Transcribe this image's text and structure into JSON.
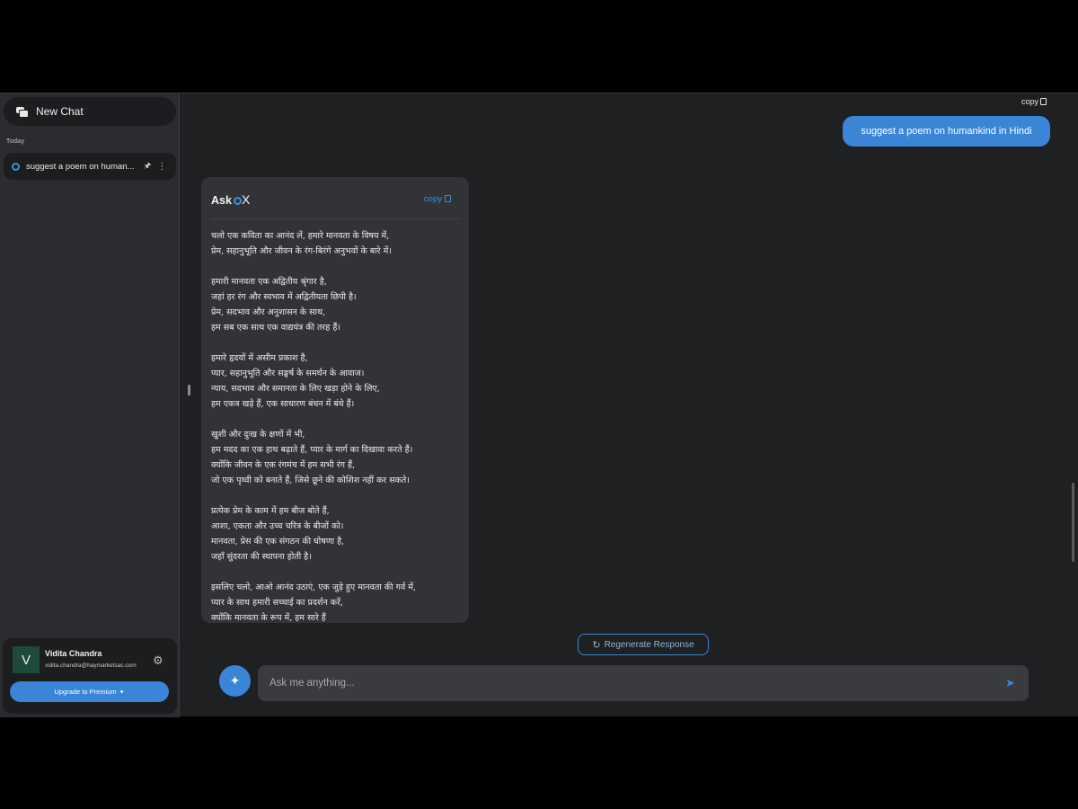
{
  "sidebar": {
    "new_chat_label": "New Chat",
    "section_label": "Today",
    "history": [
      {
        "title": "suggest a poem on human...",
        "pin_icon": "pin-icon",
        "menu_icon": "more-vertical-icon"
      }
    ],
    "user": {
      "initial": "V",
      "name": "Vidita Chandra",
      "email": "vidita.chandra@haymarketsac.com",
      "upgrade_label": "Upgrade to Premium"
    }
  },
  "conversation": {
    "top_copy_label": "copy",
    "user_message": "suggest a poem on humankind in Hindi",
    "bot": {
      "logo_text": "Ask",
      "logo_suffix": "X",
      "copy_label": "copy",
      "poem": "चलो एक कविता का आनंद लें, हमारे मानवता के विषय में,\nप्रेम, सहानुभूति और जीवन के रंग-बिरंगे अनुभवों के बारे में।\n\nहमारी मानवता एक अद्वितीय श्रृंगार है,\nजहां हर रंग और स्वभाव में अद्वितीयता छिपी है।\nप्रेम, सदभाव और अनुशासन के साथ,\nहम सब एक साथ एक वाद्ययंत्र की तरह हैं।\n\nहमारे हृदयों में असीम प्रकाश है,\nप्यार, सहानुभूति और सङ्घर्ष के समर्थन के आवाज।\nन्याय, सदभाव और समानता के लिए खड़ा होने के लिए,\nहम एकत्र खड़े हैं, एक साधारण बंधन में बंधे हैं।\n\nखुशी और दुःख के क्षणों में भी,\nहम मदद का एक हाथ बढ़ाते हैं, प्यार के मार्ग का दिखावा करते हैं।\nक्योंकि जीवन के एक रंगमंच में हम सभी रंग हैं,\nजो एक पृथ्वी को बनाते हैं, जिसे छूने की कोशिश नहीं कर सकते।\n\nप्रत्येक प्रेम के काम में हम बीज बोते हैं,\nआशा, एकता और उच्च चरित्र के बीजों को।\nमानवता, प्रेस की एक संगठन की घोषणा है,\nजहाँ सुंदरता की स्थापना होती है।\n\nइसलिए चलो, आओ आनंद उठाएं, एक जुड़े हुए मानवता की गर्व में,\nप्यार के साथ हमारी सच्चाई का प्रदर्शन करें,\nक्योंकि मानवता के रूप में, हम सारे हैं"
    }
  },
  "composer": {
    "regenerate_label": "Regenerate Response",
    "placeholder": "Ask me anything..."
  },
  "colors": {
    "accent": "#3a85d6",
    "background": "#1f2022",
    "sidebar": "#2b2c2f"
  }
}
